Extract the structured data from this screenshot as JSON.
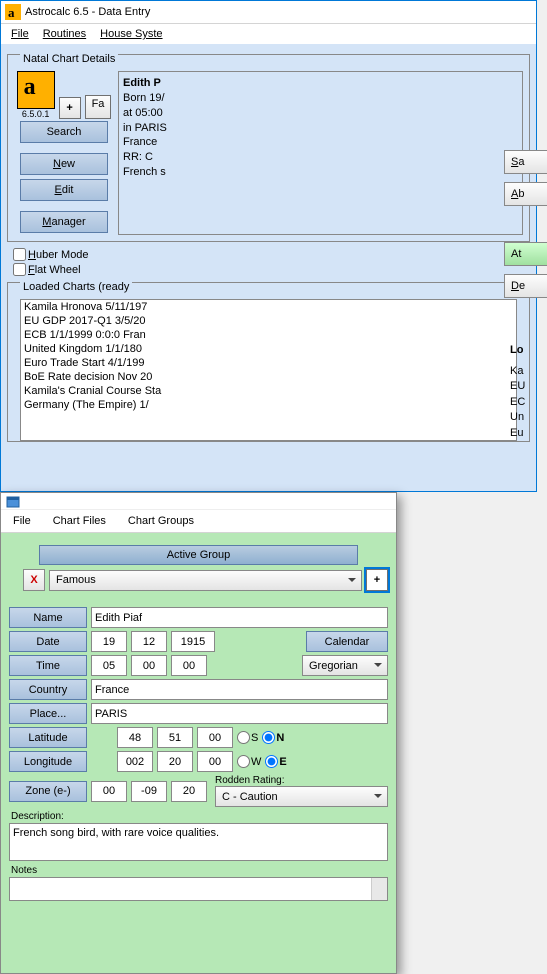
{
  "main": {
    "title": "Astrocalc 6.5 - Data Entry",
    "version": "6.5.0.1",
    "menu": {
      "file": "File",
      "routines": "Routines",
      "house": "House Syste"
    },
    "natal_label": "Natal Chart Details",
    "fav": "Fa",
    "plus": "+",
    "search": "Search",
    "new": "New",
    "edit": "Edit",
    "manager": "Manager",
    "info": {
      "name": "Edith P",
      "born": "Born 19/",
      "at": "at 05:00",
      "in": "in PARIS",
      "country": "France",
      "rr": "RR:  C",
      "desc": "French s"
    },
    "huber": "Huber Mode",
    "flat": "Flat Wheel",
    "loaded_label": "Loaded Charts (ready",
    "loaded": [
      "Kamila Hronova   5/11/197",
      "EU GDP 2017-Q1   3/5/20",
      "ECB   1/1/1999   0:0:0 Fran",
      "United Kingdom   1/1/180",
      "Euro Trade Start   4/1/199",
      "BoE Rate decision Nov 20",
      "Kamila's Cranial Course Sta",
      "Germany (The Empire)   1/"
    ]
  },
  "grp": {
    "menu": {
      "file": "File",
      "chartfiles": "Chart Files",
      "chartgroups": "Chart Groups"
    },
    "active": "Active  Group",
    "x": "X",
    "plus": "+",
    "famous": "Famous",
    "name_lbl": "Name",
    "name": "Edith Piaf",
    "date_lbl": "Date",
    "d1": "19",
    "d2": "12",
    "d3": "1915",
    "calendar": "Calendar",
    "time_lbl": "Time",
    "t1": "05",
    "t2": "00",
    "t3": "00",
    "gregorian": "Gregorian",
    "country_lbl": "Country",
    "country": "France",
    "place_lbl": "Place...",
    "place": "PARIS",
    "lat_lbl": "Latitude",
    "la1": "48",
    "la2": "51",
    "la3": "00",
    "s": "S",
    "n": "N",
    "lon_lbl": "Longitude",
    "lo1": "002",
    "lo2": "20",
    "lo3": "00",
    "w": "W",
    "e": "E",
    "zone_lbl": "Zone (e-)",
    "z1": "00",
    "z2": "-09",
    "z3": "20",
    "rodden_lbl": "Rodden Rating:",
    "rodden": "C - Caution",
    "desc_lbl": "Description:",
    "desc": "French song bird, with rare voice qualities.",
    "notes_lbl": "Notes",
    "side": {
      "save": "Sa",
      "about": "Ab",
      "att": "At",
      "del": "De"
    },
    "loaded_hint": "Lo",
    "rl": [
      "Ka",
      "EU",
      "EC",
      "Un",
      "Eu"
    ]
  }
}
